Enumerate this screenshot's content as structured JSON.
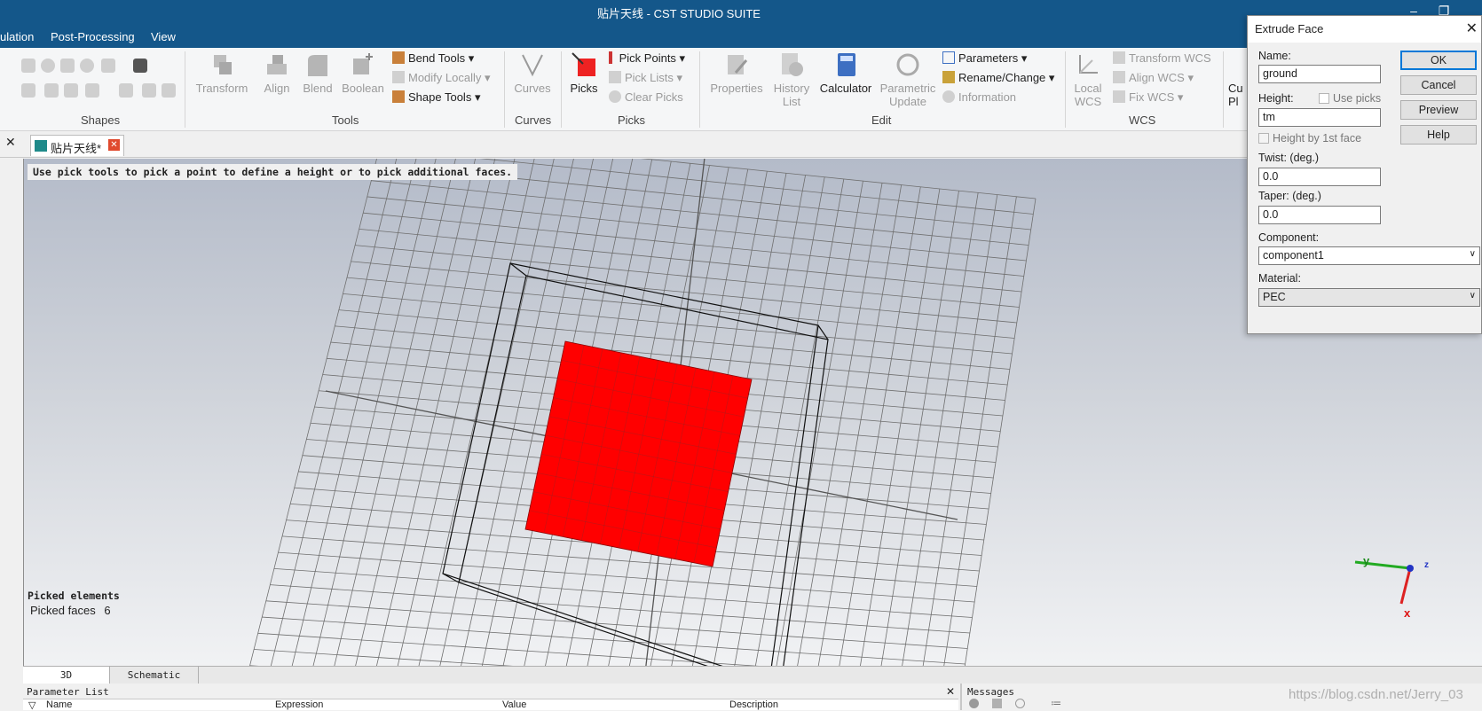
{
  "window": {
    "title": "贴片天线 - CST STUDIO SUITE",
    "minimize": "–",
    "restore": "❐",
    "close": "✕"
  },
  "menu": {
    "items": [
      "ulation",
      "Post-Processing",
      "View"
    ]
  },
  "ribbon": {
    "groups": {
      "shapes": "Shapes",
      "tools": "Tools",
      "curves": "Curves",
      "picks": "Picks",
      "edit": "Edit",
      "wcs": "WCS"
    },
    "tools": {
      "transform": "Transform",
      "align": "Align",
      "blend": "Blend",
      "boolean": "Boolean",
      "bend_tools": "Bend Tools",
      "modify_locally": "Modify Locally",
      "shape_tools": "Shape Tools"
    },
    "curves": {
      "curves": "Curves"
    },
    "picks": {
      "picks": "Picks",
      "pick_points": "Pick Points",
      "pick_lists": "Pick Lists",
      "clear_picks": "Clear Picks"
    },
    "edit": {
      "properties": "Properties",
      "history_1": "History",
      "history_2": "List",
      "calculator": "Calculator",
      "param_update_1": "Parametric",
      "param_update_2": "Update",
      "parameters": "Parameters",
      "rename_change": "Rename/Change",
      "information": "Information"
    },
    "wcs": {
      "local_1": "Local",
      "local_2": "WCS",
      "transform_wcs": "Transform WCS",
      "align_wcs": "Align WCS",
      "fix_wcs": "Fix WCS"
    },
    "cut": {
      "line1": "Cu",
      "line2": "Pl"
    }
  },
  "doc_tab": {
    "label": "贴片天线*"
  },
  "viewport": {
    "hint": "Use pick tools to pick a point to define a height or to pick additional faces.",
    "picked_title": "Picked elements",
    "picked_faces_label": "Picked faces",
    "picked_faces_count": "6",
    "axis_y": "y",
    "axis_x": "x",
    "axis_z": "z",
    "colors": {
      "face": "#ff0000",
      "grid": "#6f6f6f"
    }
  },
  "bottom_tabs": {
    "tab_3d": "3D",
    "tab_schematic": "Schematic"
  },
  "panels": {
    "parameter_list": "Parameter List",
    "messages": "Messages",
    "col_name": "Name",
    "col_expression": "Expression",
    "col_value": "Value",
    "col_description": "Description"
  },
  "dialog": {
    "title": "Extrude Face",
    "name_label": "Name:",
    "name_value": "ground",
    "height_label": "Height:",
    "use_picks": "Use picks",
    "height_value": "tm",
    "height_first_face": "Height by 1st face",
    "twist_label": "Twist: (deg.)",
    "twist_value": "0.0",
    "taper_label": "Taper: (deg.)",
    "taper_value": "0.0",
    "component_label": "Component:",
    "component_value": "component1",
    "material_label": "Material:",
    "material_value": "PEC",
    "ok": "OK",
    "cancel": "Cancel",
    "preview": "Preview",
    "help": "Help"
  },
  "watermark": "https://blog.csdn.net/Jerry_03"
}
